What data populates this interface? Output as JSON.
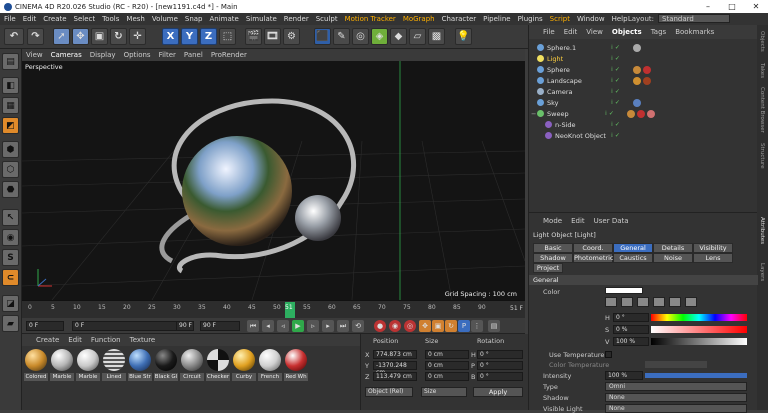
{
  "titlebar": {
    "title": "CINEMA 4D R20.026 Studio (RC - R20) - [new1191.c4d *] - Main"
  },
  "menu": {
    "items": [
      "File",
      "Edit",
      "Create",
      "Select",
      "Tools",
      "Mesh",
      "Volume",
      "Snap",
      "Animate",
      "Simulate",
      "Render",
      "Sculpt",
      "Motion Tracker",
      "MoGraph",
      "Character",
      "Pipeline",
      "Plugins",
      "Script",
      "Window",
      "Help"
    ],
    "layout_label": "Layout:",
    "layout_value": "Standard"
  },
  "toolbar": {
    "x": "X",
    "y": "Y",
    "z": "Z"
  },
  "left_tools": {
    "s_label": "S"
  },
  "viewport": {
    "menu": [
      "View",
      "Cameras",
      "Display",
      "Options",
      "Filter",
      "Panel",
      "ProRender"
    ],
    "label": "Perspective",
    "grid_spacing": "Grid Spacing : 100 cm"
  },
  "timeline": {
    "ticks": [
      "0",
      "5",
      "10",
      "15",
      "20",
      "25",
      "30",
      "35",
      "40",
      "45",
      "50",
      "51",
      "55",
      "60",
      "65",
      "70",
      "75",
      "80",
      "85",
      "90"
    ],
    "current": "51",
    "end": "51 F"
  },
  "transport": {
    "start": "0 F",
    "preview_start": "0 F",
    "preview_end": "90 F",
    "end": "90 F"
  },
  "materials": {
    "menu": [
      "Create",
      "Edit",
      "Function",
      "Texture"
    ],
    "items": [
      {
        "label": "Colored",
        "color": "#c98a2a"
      },
      {
        "label": "Marble",
        "color": "#b5b5b5"
      },
      {
        "label": "Marble",
        "color": "#c9c9c9"
      },
      {
        "label": "Lined",
        "color": "#9a9a9a"
      },
      {
        "label": "Blue Str",
        "color": "#3f6fb5"
      },
      {
        "label": "Black Gl",
        "color": "#1a1a1a"
      },
      {
        "label": "Circuit",
        "color": "#8a8a8a"
      },
      {
        "label": "Checker",
        "color": "#555555"
      },
      {
        "label": "Curby",
        "color": "#e0a020"
      },
      {
        "label": "French",
        "color": "#d0d0d0"
      },
      {
        "label": "Red Wh",
        "color": "#c83030"
      }
    ]
  },
  "coords": {
    "headers": [
      "Position",
      "Size",
      "Rotation"
    ],
    "rows": [
      {
        "axis": "X",
        "pos": "774.873 cm",
        "size": "0 cm",
        "rot_axis": "H",
        "rot": "0 °"
      },
      {
        "axis": "Y",
        "pos": "-1370.248 cm",
        "size": "0 cm",
        "rot_axis": "P",
        "rot": "0 °"
      },
      {
        "axis": "Z",
        "pos": "113.479 cm",
        "size": "0 cm",
        "rot_axis": "B",
        "rot": "0 °"
      }
    ],
    "mode": "Object (Rel)",
    "size_mode": "Size",
    "apply": "Apply"
  },
  "objects": {
    "tabs": [
      "File",
      "Edit",
      "View",
      "Objects",
      "Tags",
      "Bookmarks"
    ],
    "items": [
      {
        "name": "Sphere.1",
        "color": "#6aa0d8",
        "highlight": false,
        "tags": [
          "#aaaaaa"
        ]
      },
      {
        "name": "Light",
        "color": "#f0e060",
        "highlight": true,
        "tags": []
      },
      {
        "name": "Sphere",
        "color": "#6aa0d8",
        "highlight": false,
        "tags": [
          "#c88a3a",
          "#c03030"
        ]
      },
      {
        "name": "Landscape",
        "color": "#6aa0d8",
        "highlight": false,
        "tags": [
          "#d09030",
          "#a04020"
        ]
      },
      {
        "name": "Camera",
        "color": "#9ab0c8",
        "highlight": false,
        "tags": []
      },
      {
        "name": "Sky",
        "color": "#6aa0d8",
        "highlight": false,
        "tags": [
          "#5a80c0"
        ]
      },
      {
        "name": "Sweep",
        "color": "#6ac06a",
        "highlight": false,
        "tags": [
          "#c88a3a",
          "#c03030",
          "#d07070"
        ]
      },
      {
        "name": "n-Side",
        "color": "#8a60c0",
        "highlight": false,
        "tags": []
      },
      {
        "name": "NeoKnot Object",
        "color": "#8a60c0",
        "highlight": false,
        "tags": []
      }
    ]
  },
  "sidetabs": [
    "Objects",
    "Takes",
    "Content Browser",
    "Structure",
    "Attributes",
    "Layers"
  ],
  "attributes": {
    "menu": [
      "Mode",
      "Edit",
      "User Data"
    ],
    "title": "Light Object [Light]",
    "tabs_row1": [
      "Basic",
      "Coord.",
      "General",
      "Details",
      "Visibility"
    ],
    "tabs_row2": [
      "Shadow",
      "Photometric",
      "Caustics",
      "Noise",
      "Lens"
    ],
    "tabs_row3": [
      "Project"
    ],
    "section": "General",
    "color_label": "Color",
    "h_label": "H",
    "h_value": "0 °",
    "s_label": "S",
    "s_value": "0 %",
    "v_label": "V",
    "v_value": "100 %",
    "use_temp": "Use Temperature",
    "color_temp": "Color Temperature",
    "intensity_label": "Intensity",
    "intensity_value": "100 %",
    "type_label": "Type",
    "type_value": "Omni",
    "shadow_label": "Shadow",
    "shadow_value": "None",
    "visible_label": "Visible Light",
    "visible_value": "None"
  }
}
